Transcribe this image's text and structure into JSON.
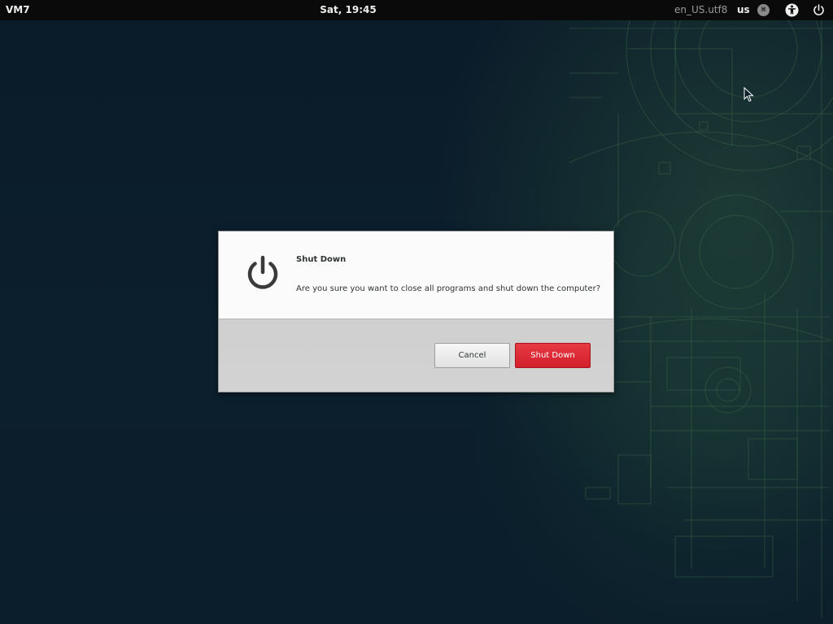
{
  "topbar": {
    "activities_label": "VM7",
    "clock": "Sat, 19:45",
    "locale": "en_US.utf8",
    "keyboard_layout": "us",
    "input_method_icon": "ibus-icon",
    "accessibility_icon": "accessibility-icon",
    "power_icon": "power-icon"
  },
  "dialog": {
    "icon": "power-icon",
    "title": "Shut Down",
    "message": "Are you sure you want to close all programs and shut down the computer?",
    "cancel_label": "Cancel",
    "confirm_label": "Shut Down"
  },
  "colors": {
    "accent_destructive": "#d9252f",
    "topbar_bg": "#0a0a0a",
    "desktop_bg": "#0b1d2b"
  }
}
